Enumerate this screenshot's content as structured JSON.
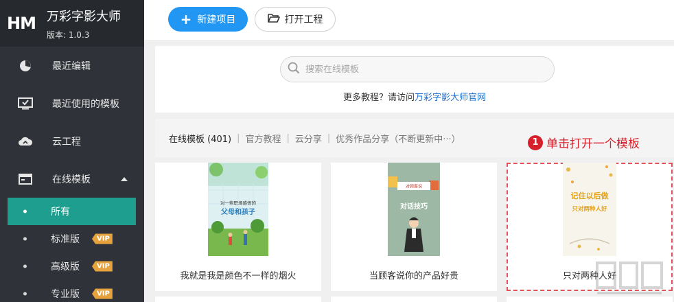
{
  "brand": {
    "logo": "HM",
    "app_name": "万彩字影大师",
    "version": "版本: 1.0.3"
  },
  "sidebar": {
    "items": [
      {
        "label": "最近编辑",
        "icon": "pie-icon"
      },
      {
        "label": "最近使用的模板",
        "icon": "monitor-check-icon"
      },
      {
        "label": "云工程",
        "icon": "cloud-icon"
      },
      {
        "label": "在线模板",
        "icon": "window-icon"
      }
    ],
    "subitems": [
      {
        "label": "所有",
        "vip": ""
      },
      {
        "label": "标准版",
        "vip": "VIP"
      },
      {
        "label": "高级版",
        "vip": "VIP"
      },
      {
        "label": "专业版",
        "vip": "VIP"
      }
    ]
  },
  "toolbar": {
    "new_label": "新建项目",
    "open_label": "打开工程"
  },
  "search": {
    "placeholder": "搜索在线模板",
    "tutorial_text": "更多教程？请访问",
    "tutorial_link": "万彩字影大师官网"
  },
  "filters": {
    "tabs": [
      "在线模板 (401)",
      "官方教程",
      "云分享",
      "优秀作品分享（不断更新中···）"
    ],
    "separator": "|"
  },
  "annotation": {
    "number": "1",
    "text": "单击打开一个模板"
  },
  "cards": [
    {
      "title": "我就是我是颜色不一样的烟火",
      "thumb_line1": "对一些职场感悟的",
      "thumb_line2": "父母和孩子"
    },
    {
      "title": "当顾客说你的产品好贵",
      "thumb_line1": "对顾客说",
      "thumb_line2": "对话技巧"
    },
    {
      "title": "只对两种人好",
      "thumb_line1": "记住以后做",
      "thumb_line2": "只对两种人好"
    }
  ],
  "colors": {
    "sidebar_bg": "#2f3238",
    "active_teal": "#1e9e8e",
    "primary_blue": "#2196f3",
    "vip_orange": "#e6a23c",
    "annotation_red": "#d6202c"
  }
}
